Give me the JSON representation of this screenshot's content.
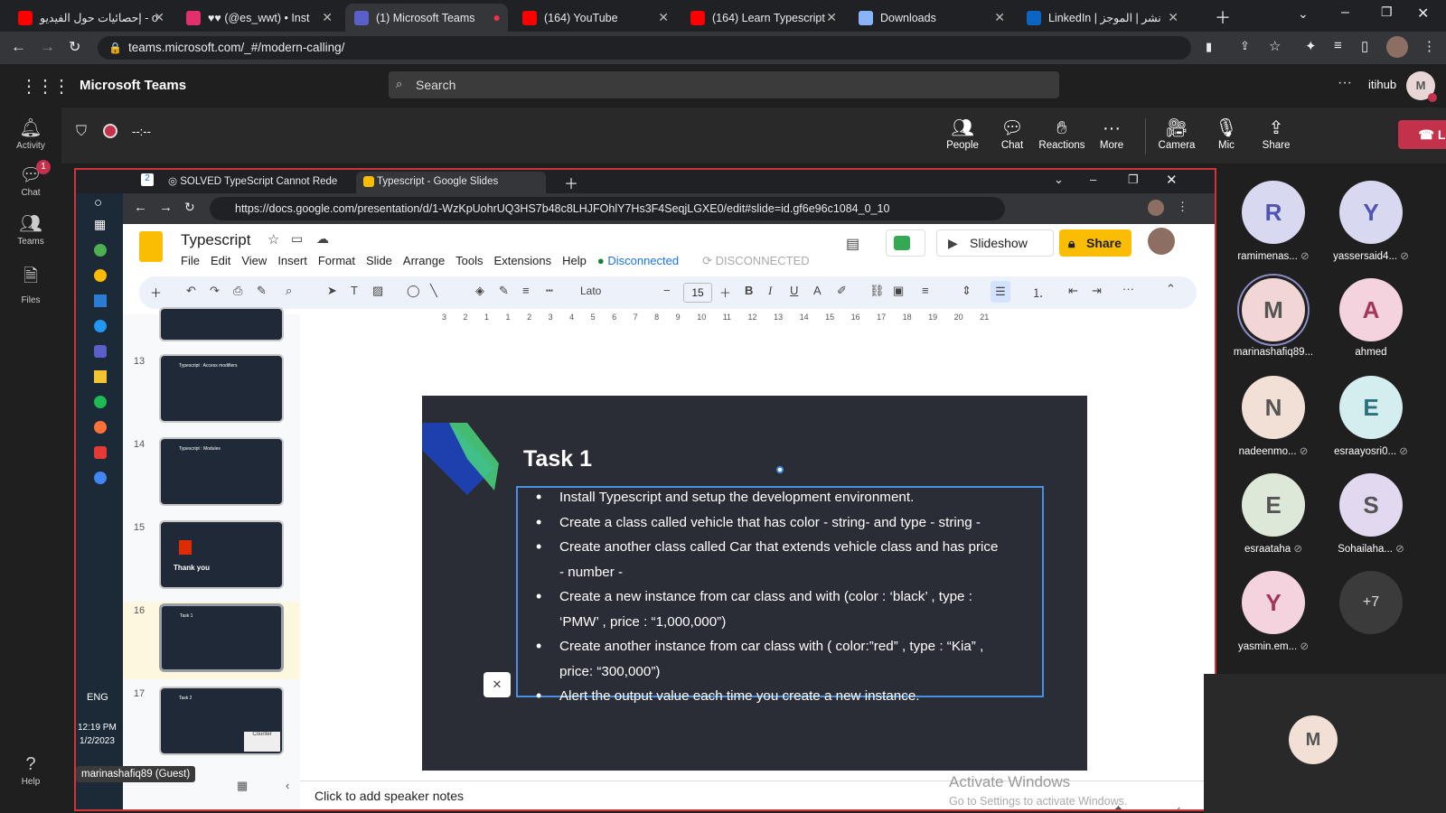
{
  "browser": {
    "tabs": [
      {
        "title": "إحصائيات حول الفيديو - o",
        "icon": "youtube-icon",
        "color": "#ff0000"
      },
      {
        "title": "♥♥ (@es_wwt) • Inst",
        "icon": "instagram-icon",
        "color": "#e1306c"
      },
      {
        "title": "(1) Microsoft Teams",
        "icon": "teams-icon",
        "color": "#5b5fc7"
      },
      {
        "title": "(164) YouTube",
        "icon": "youtube-icon",
        "color": "#ff0000"
      },
      {
        "title": "(164) Learn Typescript",
        "icon": "youtube-icon",
        "color": "#ff0000"
      },
      {
        "title": "Downloads",
        "icon": "download-icon",
        "color": "#8ab4f8"
      },
      {
        "title": "LinkedIn | نشر | الموجز",
        "icon": "linkedin-icon",
        "color": "#0a66c2"
      }
    ],
    "url": "teams.microsoft.com/_#/modern-calling/"
  },
  "teams": {
    "app_title": "Microsoft Teams",
    "search_placeholder": "Search",
    "org": "itihub",
    "user_initial": "M",
    "rail": [
      {
        "label": "Activity",
        "icon": "bell-icon"
      },
      {
        "label": "Chat",
        "icon": "chat-icon",
        "badge": "1"
      },
      {
        "label": "Teams",
        "icon": "teams-icon"
      },
      {
        "label": "Files",
        "icon": "file-icon"
      },
      {
        "label": "Help",
        "icon": "help-icon"
      }
    ],
    "call_timer": "--:--",
    "call_controls": [
      {
        "label": "People",
        "icon": "people-icon"
      },
      {
        "label": "Chat",
        "icon": "chat-icon"
      },
      {
        "label": "Reactions",
        "icon": "reactions-icon"
      },
      {
        "label": "More",
        "icon": "more-icon"
      },
      {
        "label": "Camera",
        "icon": "camera-off-icon"
      },
      {
        "label": "Mic",
        "icon": "mic-off-icon"
      },
      {
        "label": "Share",
        "icon": "share-icon"
      }
    ],
    "leave_label": "Leave",
    "presenter_label": "marinashafiq89 (Guest)"
  },
  "shared": {
    "tabs": [
      {
        "title": "SOLVED TypeScript Cannot Rede"
      },
      {
        "title": "Typescript - Google Slides"
      }
    ],
    "url": "https://docs.google.com/presentation/d/1-WzKpUohrUQ3HS7b48c8LHJFOhlY7Hs3F4SeqjLGXE0/edit#slide=id.gf6e96c1084_0_10",
    "taskbar": {
      "lang": "ENG",
      "time": "12:19 PM",
      "date": "1/2/2023"
    },
    "slides": {
      "doc_title": "Typescript",
      "menu": [
        "File",
        "Edit",
        "View",
        "Insert",
        "Format",
        "Slide",
        "Arrange",
        "Tools",
        "Extensions",
        "Help"
      ],
      "status": "Disconnected",
      "status2": "DISCONNECTED",
      "slideshow_label": "Slideshow",
      "share_label": "Share",
      "font": "Lato",
      "font_size": "15",
      "ruler": [
        "3",
        "2",
        "1",
        "1",
        "2",
        "3",
        "4",
        "5",
        "6",
        "7",
        "8",
        "9",
        "10",
        "11",
        "12",
        "13",
        "14",
        "15",
        "16",
        "17",
        "18",
        "19",
        "20",
        "21"
      ],
      "thumbs": [
        {
          "num": "13",
          "title": "Typescript : Access modifiers"
        },
        {
          "num": "14",
          "title": "Typescript : Modules"
        },
        {
          "num": "15",
          "title": "Thank you"
        },
        {
          "num": "16",
          "title": "Task 1"
        },
        {
          "num": "17",
          "title": "Task 2",
          "badge": "Counter"
        }
      ],
      "slide_title": "Task 1",
      "bullets": [
        "Install Typescript and setup the development environment.",
        "Create a class called vehicle that has  color - string- and type - string -",
        "Create another class called Car that extends vehicle class and has  price - number -",
        "Create a new instance from car class and with (color : ‘black’ , type :  ‘PMW’ , price : “1,000,000”)",
        "Create another instance from car class with ( color:”red” , type : “Kia” , price: “300,000”)",
        "Alert the output value each time you create a new instance."
      ],
      "speaker_notes": "Click to add speaker notes",
      "watermark_title": "Activate Windows",
      "watermark_sub": "Go to Settings to activate Windows."
    }
  },
  "participants": [
    {
      "initial": "R",
      "name": "ramimenas...",
      "bg": "#d8d8f0",
      "color": "#4f52b2"
    },
    {
      "initial": "Y",
      "name": "yassersaid4...",
      "bg": "#d8d8f0",
      "color": "#4f52b2"
    },
    {
      "initial": "M",
      "name": "marinashafiq89...",
      "bg": "#f2d5d5",
      "color": "#555"
    },
    {
      "initial": "A",
      "name": "ahmed",
      "bg": "#f4d3de",
      "color": "#a0365a"
    },
    {
      "initial": "N",
      "name": "nadeenmo...",
      "bg": "#f2dfd5",
      "color": "#555"
    },
    {
      "initial": "E",
      "name": "esraayosri0...",
      "bg": "#d4eef0",
      "color": "#2a6f7a"
    },
    {
      "initial": "E",
      "name": "esraataha",
      "bg": "#dde8d8",
      "color": "#555"
    },
    {
      "initial": "S",
      "name": "Sohailaha...",
      "bg": "#e2d8f0",
      "color": "#555"
    },
    {
      "initial": "Y",
      "name": "yasmin.em...",
      "bg": "#f4d3de",
      "color": "#a0365a"
    }
  ],
  "more_count": "+7",
  "self_initial": "M"
}
